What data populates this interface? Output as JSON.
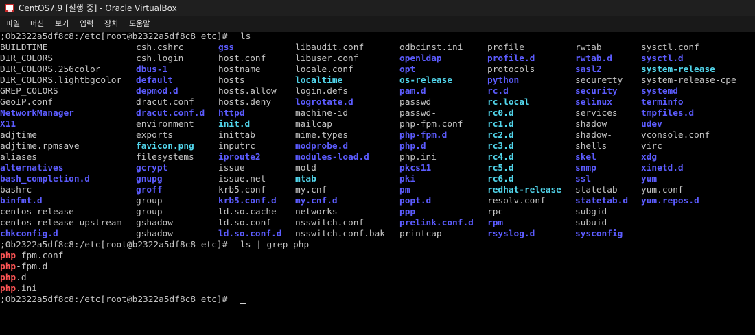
{
  "window": {
    "title": "CentOS7.9 [실행 중] - Oracle VirtualBox",
    "menu": [
      "파일",
      "머신",
      "보기",
      "입력",
      "장치",
      "도움말"
    ]
  },
  "terminal": {
    "colors": {
      "background": "#000000",
      "text": "#c4c4c4",
      "directory": "#5c5cff",
      "symlink": "#52d6ec",
      "grep_match": "#ff5555"
    },
    "prompt": ";0b2322a5df8c8:/etc[root@b2322a5df8c8 etc]# ",
    "commands": [
      "ls",
      "ls | grep php"
    ],
    "ls_columns": [
      [
        {
          "n": "BUILDTIME",
          "t": "plain"
        },
        {
          "n": "DIR_COLORS",
          "t": "plain"
        },
        {
          "n": "DIR_COLORS.256color",
          "t": "plain"
        },
        {
          "n": "DIR_COLORS.lightbgcolor",
          "t": "plain"
        },
        {
          "n": "GREP_COLORS",
          "t": "plain"
        },
        {
          "n": "GeoIP.conf",
          "t": "plain"
        },
        {
          "n": "NetworkManager",
          "t": "dir"
        },
        {
          "n": "X11",
          "t": "dir"
        },
        {
          "n": "adjtime",
          "t": "plain"
        },
        {
          "n": "adjtime.rpmsave",
          "t": "plain"
        },
        {
          "n": "aliases",
          "t": "plain"
        },
        {
          "n": "alternatives",
          "t": "dir"
        },
        {
          "n": "bash_completion.d",
          "t": "dir"
        },
        {
          "n": "bashrc",
          "t": "plain"
        },
        {
          "n": "binfmt.d",
          "t": "dir"
        },
        {
          "n": "centos-release",
          "t": "plain"
        },
        {
          "n": "centos-release-upstream",
          "t": "plain"
        },
        {
          "n": "chkconfig.d",
          "t": "dir"
        }
      ],
      [
        {
          "n": "csh.cshrc",
          "t": "plain"
        },
        {
          "n": "csh.login",
          "t": "plain"
        },
        {
          "n": "dbus-1",
          "t": "dir"
        },
        {
          "n": "default",
          "t": "dir"
        },
        {
          "n": "depmod.d",
          "t": "dir"
        },
        {
          "n": "dracut.conf",
          "t": "plain"
        },
        {
          "n": "dracut.conf.d",
          "t": "dir"
        },
        {
          "n": "environment",
          "t": "plain"
        },
        {
          "n": "exports",
          "t": "plain"
        },
        {
          "n": "favicon.png",
          "t": "link"
        },
        {
          "n": "filesystems",
          "t": "plain"
        },
        {
          "n": "gcrypt",
          "t": "dir"
        },
        {
          "n": "gnupg",
          "t": "dir"
        },
        {
          "n": "groff",
          "t": "dir"
        },
        {
          "n": "group",
          "t": "plain"
        },
        {
          "n": "group-",
          "t": "plain"
        },
        {
          "n": "gshadow",
          "t": "plain"
        },
        {
          "n": "gshadow-",
          "t": "plain"
        }
      ],
      [
        {
          "n": "gss",
          "t": "dir"
        },
        {
          "n": "host.conf",
          "t": "plain"
        },
        {
          "n": "hostname",
          "t": "plain"
        },
        {
          "n": "hosts",
          "t": "plain"
        },
        {
          "n": "hosts.allow",
          "t": "plain"
        },
        {
          "n": "hosts.deny",
          "t": "plain"
        },
        {
          "n": "httpd",
          "t": "dir"
        },
        {
          "n": "init.d",
          "t": "link"
        },
        {
          "n": "inittab",
          "t": "plain"
        },
        {
          "n": "inputrc",
          "t": "plain"
        },
        {
          "n": "iproute2",
          "t": "dir"
        },
        {
          "n": "issue",
          "t": "plain"
        },
        {
          "n": "issue.net",
          "t": "plain"
        },
        {
          "n": "krb5.conf",
          "t": "plain"
        },
        {
          "n": "krb5.conf.d",
          "t": "dir"
        },
        {
          "n": "ld.so.cache",
          "t": "plain"
        },
        {
          "n": "ld.so.conf",
          "t": "plain"
        },
        {
          "n": "ld.so.conf.d",
          "t": "dir"
        }
      ],
      [
        {
          "n": "libaudit.conf",
          "t": "plain"
        },
        {
          "n": "libuser.conf",
          "t": "plain"
        },
        {
          "n": "locale.conf",
          "t": "plain"
        },
        {
          "n": "localtime",
          "t": "link"
        },
        {
          "n": "login.defs",
          "t": "plain"
        },
        {
          "n": "logrotate.d",
          "t": "dir"
        },
        {
          "n": "machine-id",
          "t": "plain"
        },
        {
          "n": "mailcap",
          "t": "plain"
        },
        {
          "n": "mime.types",
          "t": "plain"
        },
        {
          "n": "modprobe.d",
          "t": "dir"
        },
        {
          "n": "modules-load.d",
          "t": "dir"
        },
        {
          "n": "motd",
          "t": "plain"
        },
        {
          "n": "mtab",
          "t": "link"
        },
        {
          "n": "my.cnf",
          "t": "plain"
        },
        {
          "n": "my.cnf.d",
          "t": "dir"
        },
        {
          "n": "networks",
          "t": "plain"
        },
        {
          "n": "nsswitch.conf",
          "t": "plain"
        },
        {
          "n": "nsswitch.conf.bak",
          "t": "plain"
        }
      ],
      [
        {
          "n": "odbcinst.ini",
          "t": "plain"
        },
        {
          "n": "openldap",
          "t": "dir"
        },
        {
          "n": "opt",
          "t": "dir"
        },
        {
          "n": "os-release",
          "t": "link"
        },
        {
          "n": "pam.d",
          "t": "dir"
        },
        {
          "n": "passwd",
          "t": "plain"
        },
        {
          "n": "passwd-",
          "t": "plain"
        },
        {
          "n": "php-fpm.conf",
          "t": "plain"
        },
        {
          "n": "php-fpm.d",
          "t": "dir"
        },
        {
          "n": "php.d",
          "t": "dir"
        },
        {
          "n": "php.ini",
          "t": "plain"
        },
        {
          "n": "pkcs11",
          "t": "dir"
        },
        {
          "n": "pki",
          "t": "dir"
        },
        {
          "n": "pm",
          "t": "dir"
        },
        {
          "n": "popt.d",
          "t": "dir"
        },
        {
          "n": "ppp",
          "t": "dir"
        },
        {
          "n": "prelink.conf.d",
          "t": "dir"
        },
        {
          "n": "printcap",
          "t": "plain"
        }
      ],
      [
        {
          "n": "profile",
          "t": "plain"
        },
        {
          "n": "profile.d",
          "t": "dir"
        },
        {
          "n": "protocols",
          "t": "plain"
        },
        {
          "n": "python",
          "t": "dir"
        },
        {
          "n": "rc.d",
          "t": "dir"
        },
        {
          "n": "rc.local",
          "t": "link"
        },
        {
          "n": "rc0.d",
          "t": "link"
        },
        {
          "n": "rc1.d",
          "t": "link"
        },
        {
          "n": "rc2.d",
          "t": "link"
        },
        {
          "n": "rc3.d",
          "t": "link"
        },
        {
          "n": "rc4.d",
          "t": "link"
        },
        {
          "n": "rc5.d",
          "t": "link"
        },
        {
          "n": "rc6.d",
          "t": "link"
        },
        {
          "n": "redhat-release",
          "t": "link"
        },
        {
          "n": "resolv.conf",
          "t": "plain"
        },
        {
          "n": "rpc",
          "t": "plain"
        },
        {
          "n": "rpm",
          "t": "dir"
        },
        {
          "n": "rsyslog.d",
          "t": "dir"
        }
      ],
      [
        {
          "n": "rwtab",
          "t": "plain"
        },
        {
          "n": "rwtab.d",
          "t": "dir"
        },
        {
          "n": "sasl2",
          "t": "dir"
        },
        {
          "n": "securetty",
          "t": "plain"
        },
        {
          "n": "security",
          "t": "dir"
        },
        {
          "n": "selinux",
          "t": "dir"
        },
        {
          "n": "services",
          "t": "plain"
        },
        {
          "n": "shadow",
          "t": "plain"
        },
        {
          "n": "shadow-",
          "t": "plain"
        },
        {
          "n": "shells",
          "t": "plain"
        },
        {
          "n": "skel",
          "t": "dir"
        },
        {
          "n": "snmp",
          "t": "dir"
        },
        {
          "n": "ssl",
          "t": "dir"
        },
        {
          "n": "statetab",
          "t": "plain"
        },
        {
          "n": "statetab.d",
          "t": "dir"
        },
        {
          "n": "subgid",
          "t": "plain"
        },
        {
          "n": "subuid",
          "t": "plain"
        },
        {
          "n": "sysconfig",
          "t": "dir"
        }
      ],
      [
        {
          "n": "sysctl.conf",
          "t": "plain"
        },
        {
          "n": "sysctl.d",
          "t": "dir"
        },
        {
          "n": "system-release",
          "t": "link"
        },
        {
          "n": "system-release-cpe",
          "t": "plain"
        },
        {
          "n": "systemd",
          "t": "dir"
        },
        {
          "n": "terminfo",
          "t": "dir"
        },
        {
          "n": "tmpfiles.d",
          "t": "dir"
        },
        {
          "n": "udev",
          "t": "dir"
        },
        {
          "n": "vconsole.conf",
          "t": "plain"
        },
        {
          "n": "virc",
          "t": "plain"
        },
        {
          "n": "xdg",
          "t": "dir"
        },
        {
          "n": "xinetd.d",
          "t": "dir"
        },
        {
          "n": "yum",
          "t": "dir"
        },
        {
          "n": "yum.conf",
          "t": "plain"
        },
        {
          "n": "yum.repos.d",
          "t": "dir"
        }
      ]
    ],
    "grep_results": [
      {
        "match": "php",
        "rest": "-fpm.conf"
      },
      {
        "match": "php",
        "rest": "-fpm.d"
      },
      {
        "match": "php",
        "rest": ".d"
      },
      {
        "match": "php",
        "rest": ".ini"
      }
    ]
  }
}
